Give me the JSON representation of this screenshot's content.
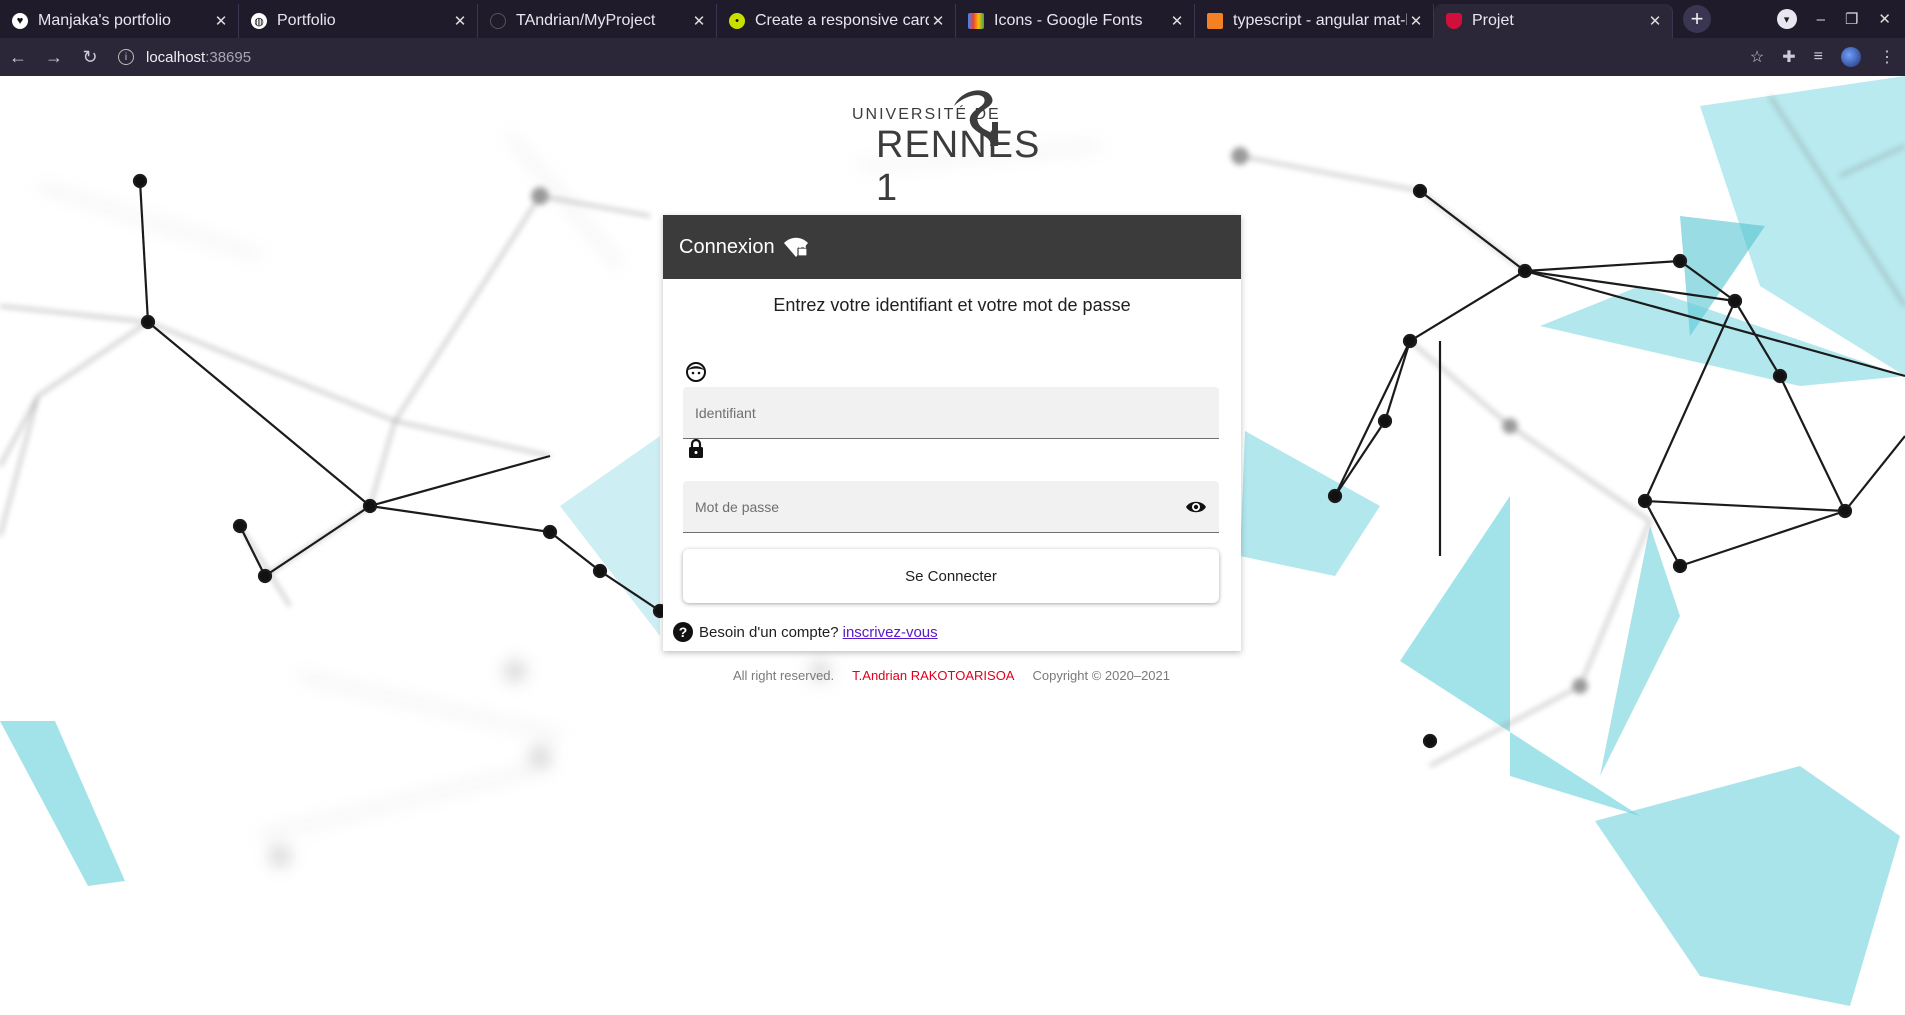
{
  "browser": {
    "tabs": [
      {
        "title": "Manjaka's portfolio",
        "icon": "heart-icon",
        "active": false
      },
      {
        "title": "Portfolio",
        "icon": "globe-icon",
        "active": false
      },
      {
        "title": "TAndrian/MyProject",
        "icon": "github-icon",
        "active": false
      },
      {
        "title": "Create a responsive card g",
        "icon": "bulb-icon",
        "active": false
      },
      {
        "title": "Icons - Google Fonts",
        "icon": "google-fonts-icon",
        "active": false
      },
      {
        "title": "typescript - angular mat-b",
        "icon": "stackoverflow-icon",
        "active": false
      },
      {
        "title": "Projet",
        "icon": "shield-icon",
        "active": true
      }
    ],
    "address": {
      "host": "localhost",
      "port": ":38695"
    }
  },
  "logo": {
    "line1": "UNIVERSITÉ DE",
    "line2": "RENNES 1"
  },
  "card": {
    "title": "Connexion",
    "subtitle": "Entrez votre identifiant et votre mot de passe",
    "username_placeholder": "Identifiant",
    "password_placeholder": "Mot de passe",
    "submit_label": "Se Connecter",
    "help_text": "Besoin d'un compte?",
    "signup_link": "inscrivez-vous"
  },
  "footer": {
    "rights": "All right reserved.",
    "author": "T.Andrian RAKOTOARISOA",
    "copyright": "Copyright © 2020–2021"
  },
  "colors": {
    "header": "#3b3b3b",
    "accent": "#00b3c7",
    "author": "#e0001b",
    "link": "#5a19c8"
  }
}
